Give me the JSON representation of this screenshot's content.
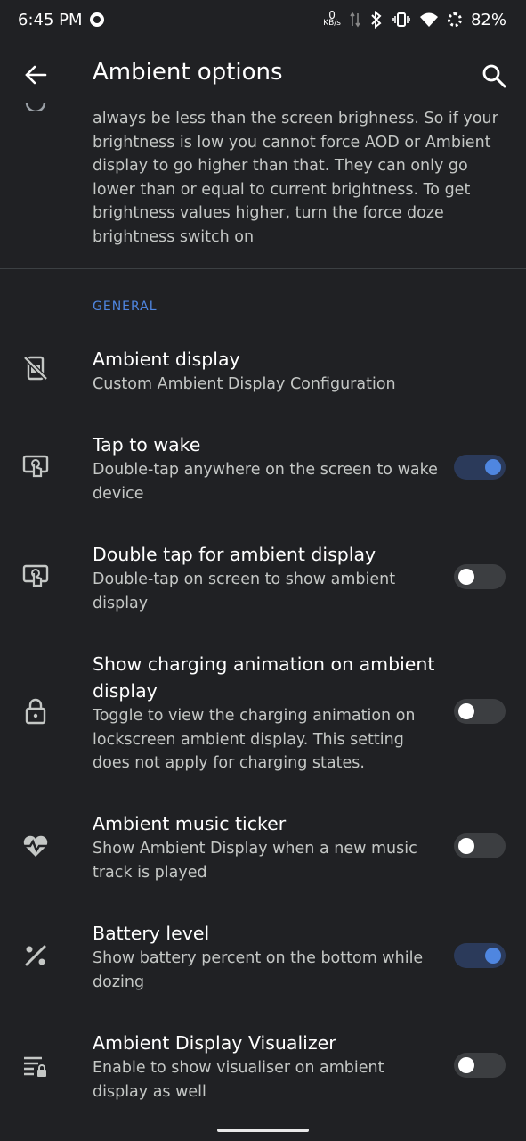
{
  "status_bar": {
    "time": "6:45 PM",
    "net_speed_value": "0",
    "net_speed_unit": "KB/s",
    "battery": "82%",
    "icons": [
      "record-icon",
      "data-arrows-icon",
      "bluetooth-icon",
      "vibrate-icon",
      "wifi-icon",
      "battery-saver-icon"
    ]
  },
  "app_bar": {
    "title": "Ambient options",
    "back_icon": "arrow-back-icon",
    "search_icon": "search-icon"
  },
  "description": "always be less than the screen brighness. So if your brightness is low you cannot force AOD or Ambient display to go higher than that. They can only go lower than or equal to current brightness. To get brightness values higher, turn the force doze brightness switch on",
  "section": {
    "header": "GENERAL"
  },
  "items": [
    {
      "title": "Ambient display",
      "subtitle": "Custom Ambient Display Configuration",
      "icon": "doze-off-icon"
    },
    {
      "title": "Tap to wake",
      "subtitle": "Double-tap anywhere on the screen to wake device",
      "icon": "tap-screen-icon",
      "toggle": true
    },
    {
      "title": "Double tap for ambient display",
      "subtitle": "Double-tap on screen to show ambient display",
      "icon": "tap-screen-icon",
      "toggle": false
    },
    {
      "title": "Show charging animation on ambient display",
      "subtitle": "Toggle to view the charging animation on lockscreen ambient display. This setting does not apply for charging states.",
      "icon": "lock-icon",
      "toggle": false
    },
    {
      "title": "Ambient music ticker",
      "subtitle": "Show Ambient Display when a new music track is played",
      "icon": "heart-pulse-icon",
      "toggle": false
    },
    {
      "title": "Battery level",
      "subtitle": "Show battery percent on the bottom while dozing",
      "icon": "percent-icon",
      "toggle": true
    },
    {
      "title": "Ambient Display Visualizer",
      "subtitle": "Enable to show visualiser on ambient display as well",
      "icon": "visualizer-lock-icon",
      "toggle": false
    }
  ],
  "colors": {
    "background": "#202124",
    "accent": "#4f86e0",
    "secondary_text": "#c4c7c5"
  }
}
